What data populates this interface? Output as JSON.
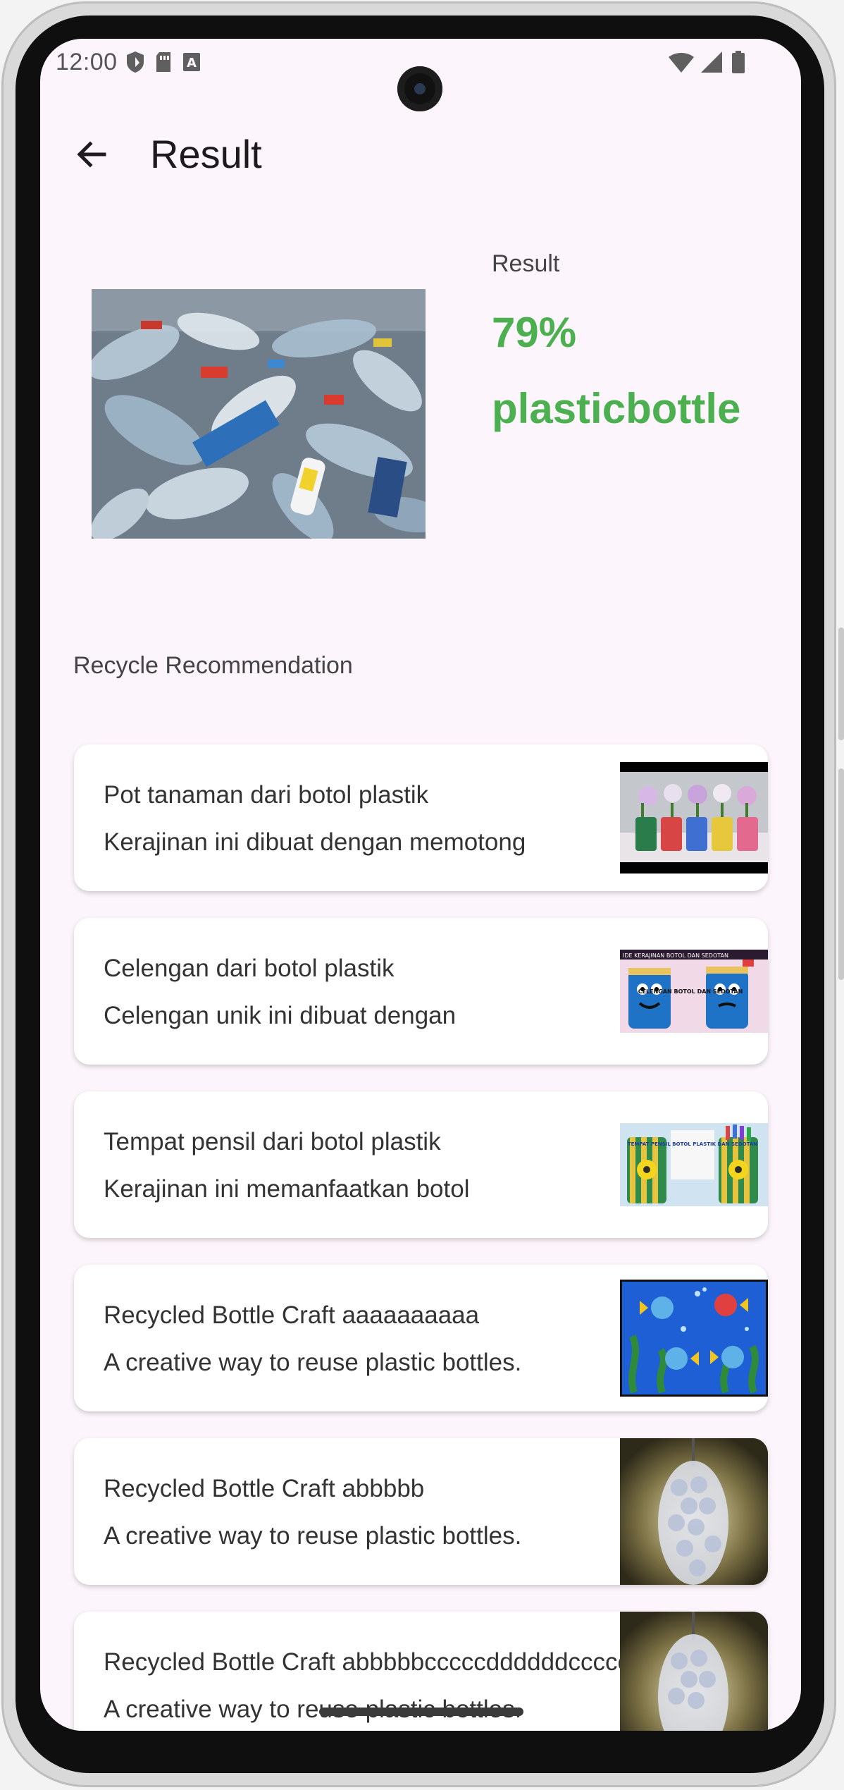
{
  "status_bar": {
    "time": "12:00",
    "left_icons": [
      "shield-icon",
      "sim-card-icon",
      "text-a-icon"
    ],
    "right_icons": [
      "wifi-icon",
      "signal-icon",
      "battery-icon"
    ]
  },
  "app_bar": {
    "back_icon": "arrow-left-icon",
    "title": "Result"
  },
  "result": {
    "label": "Result",
    "confidence": "79%",
    "class_name": "plasticbottle",
    "accent_color": "#4caf50",
    "image_alt": "pile of plastic bottles"
  },
  "recommendation": {
    "section_title": "Recycle Recommendation",
    "items": [
      {
        "title": "Pot tanaman dari botol plastik",
        "description": "Kerajinan ini dibuat dengan memotong"
      },
      {
        "title": "Celengan dari botol plastik",
        "description": "Celengan unik ini dibuat dengan"
      },
      {
        "title": "Tempat pensil dari botol plastik",
        "description": "Kerajinan ini memanfaatkan botol"
      },
      {
        "title": "Recycled Bottle Craft aaaaaaaaaa",
        "description": "A creative way to reuse plastic bottles."
      },
      {
        "title": "Recycled Bottle Craft abbbbb",
        "description": "A creative way to reuse plastic bottles."
      },
      {
        "title": "Recycled Bottle Craft abbbbbcccccddddddcccccc",
        "description": "A creative way to reuse plastic bottles."
      }
    ],
    "thumb_texts": {
      "celengan_banner": "IDE KERAJINAN BOTOL DAN SEDOTAN",
      "celengan_caption": "CELENGAN BOTOL DAN SEDOTAN",
      "pensil_caption": "TEMPAT PENSIL BOTOL PLASTIK DAN SEDOTAN"
    }
  }
}
